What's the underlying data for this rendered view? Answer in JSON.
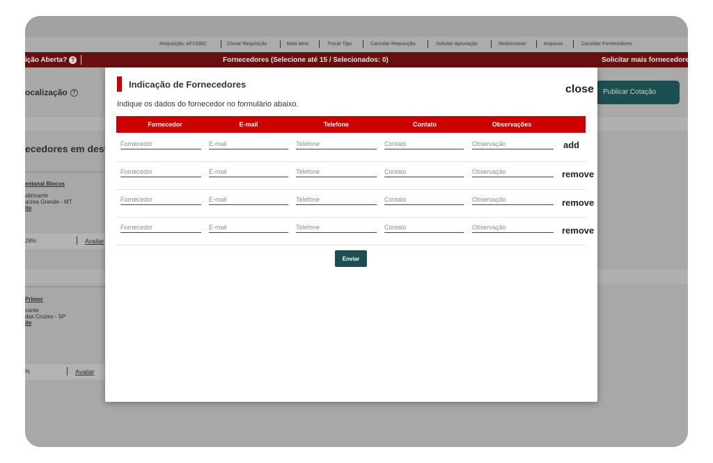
{
  "nav": {
    "links": [
      {
        "id": "req",
        "label": "Requisição: AFV3382"
      },
      {
        "id": "clonar",
        "label": "Clonar Requisição"
      },
      {
        "id": "mais",
        "label": "Mais itens"
      },
      {
        "id": "trocar",
        "label": "Trocar Tipo"
      },
      {
        "id": "cancelar",
        "label": "Cancelar Requisição"
      },
      {
        "id": "solicitar",
        "label": "Solicitar Aprovação"
      },
      {
        "id": "redirecionar",
        "label": "Redirecionar"
      },
      {
        "id": "arquivos",
        "label": "Arquivos"
      },
      {
        "id": "convidar",
        "label": "Convidar Fornecedores"
      }
    ]
  },
  "redbar": {
    "left": "ição Aberta?",
    "help": "?",
    "center": "Fornecedores (Selecione até 15 / Selecionados: 0)",
    "right": "Solicitar mais fornecedore"
  },
  "background": {
    "localization": "ocalização",
    "localization_icon": "?",
    "section_title": "ecedores em desta",
    "publish_button": "Publicar Cotação",
    "card1": {
      "name": "entanal Blocos",
      "type": "abricante",
      "city": "arzea Grande - MT",
      "site": "ite",
      "stat": "28%",
      "rate": "Avaliar"
    },
    "card2": {
      "name": "Primor",
      "type": "cante",
      "city": "das Cruzes - SP",
      "site": "ite",
      "stat": "%",
      "rate": "Avaliar"
    }
  },
  "modal": {
    "title": "Indicação de Fornecedores",
    "close": "close",
    "subtitle": "Indique os dados do fornecedor no formulário abaixo.",
    "columns": [
      "Fornecedor",
      "E-mail",
      "Telefone",
      "Contato",
      "Observações"
    ],
    "placeholders": {
      "fornecedor": "Fornecedor",
      "email": "E-mail",
      "telefone": "Telefone",
      "contato": "Contato",
      "observacao": "Observação"
    },
    "rows": [
      {
        "action": "add"
      },
      {
        "action": "remove"
      },
      {
        "action": "remove"
      },
      {
        "action": "remove"
      }
    ],
    "submit": "Enviar"
  }
}
